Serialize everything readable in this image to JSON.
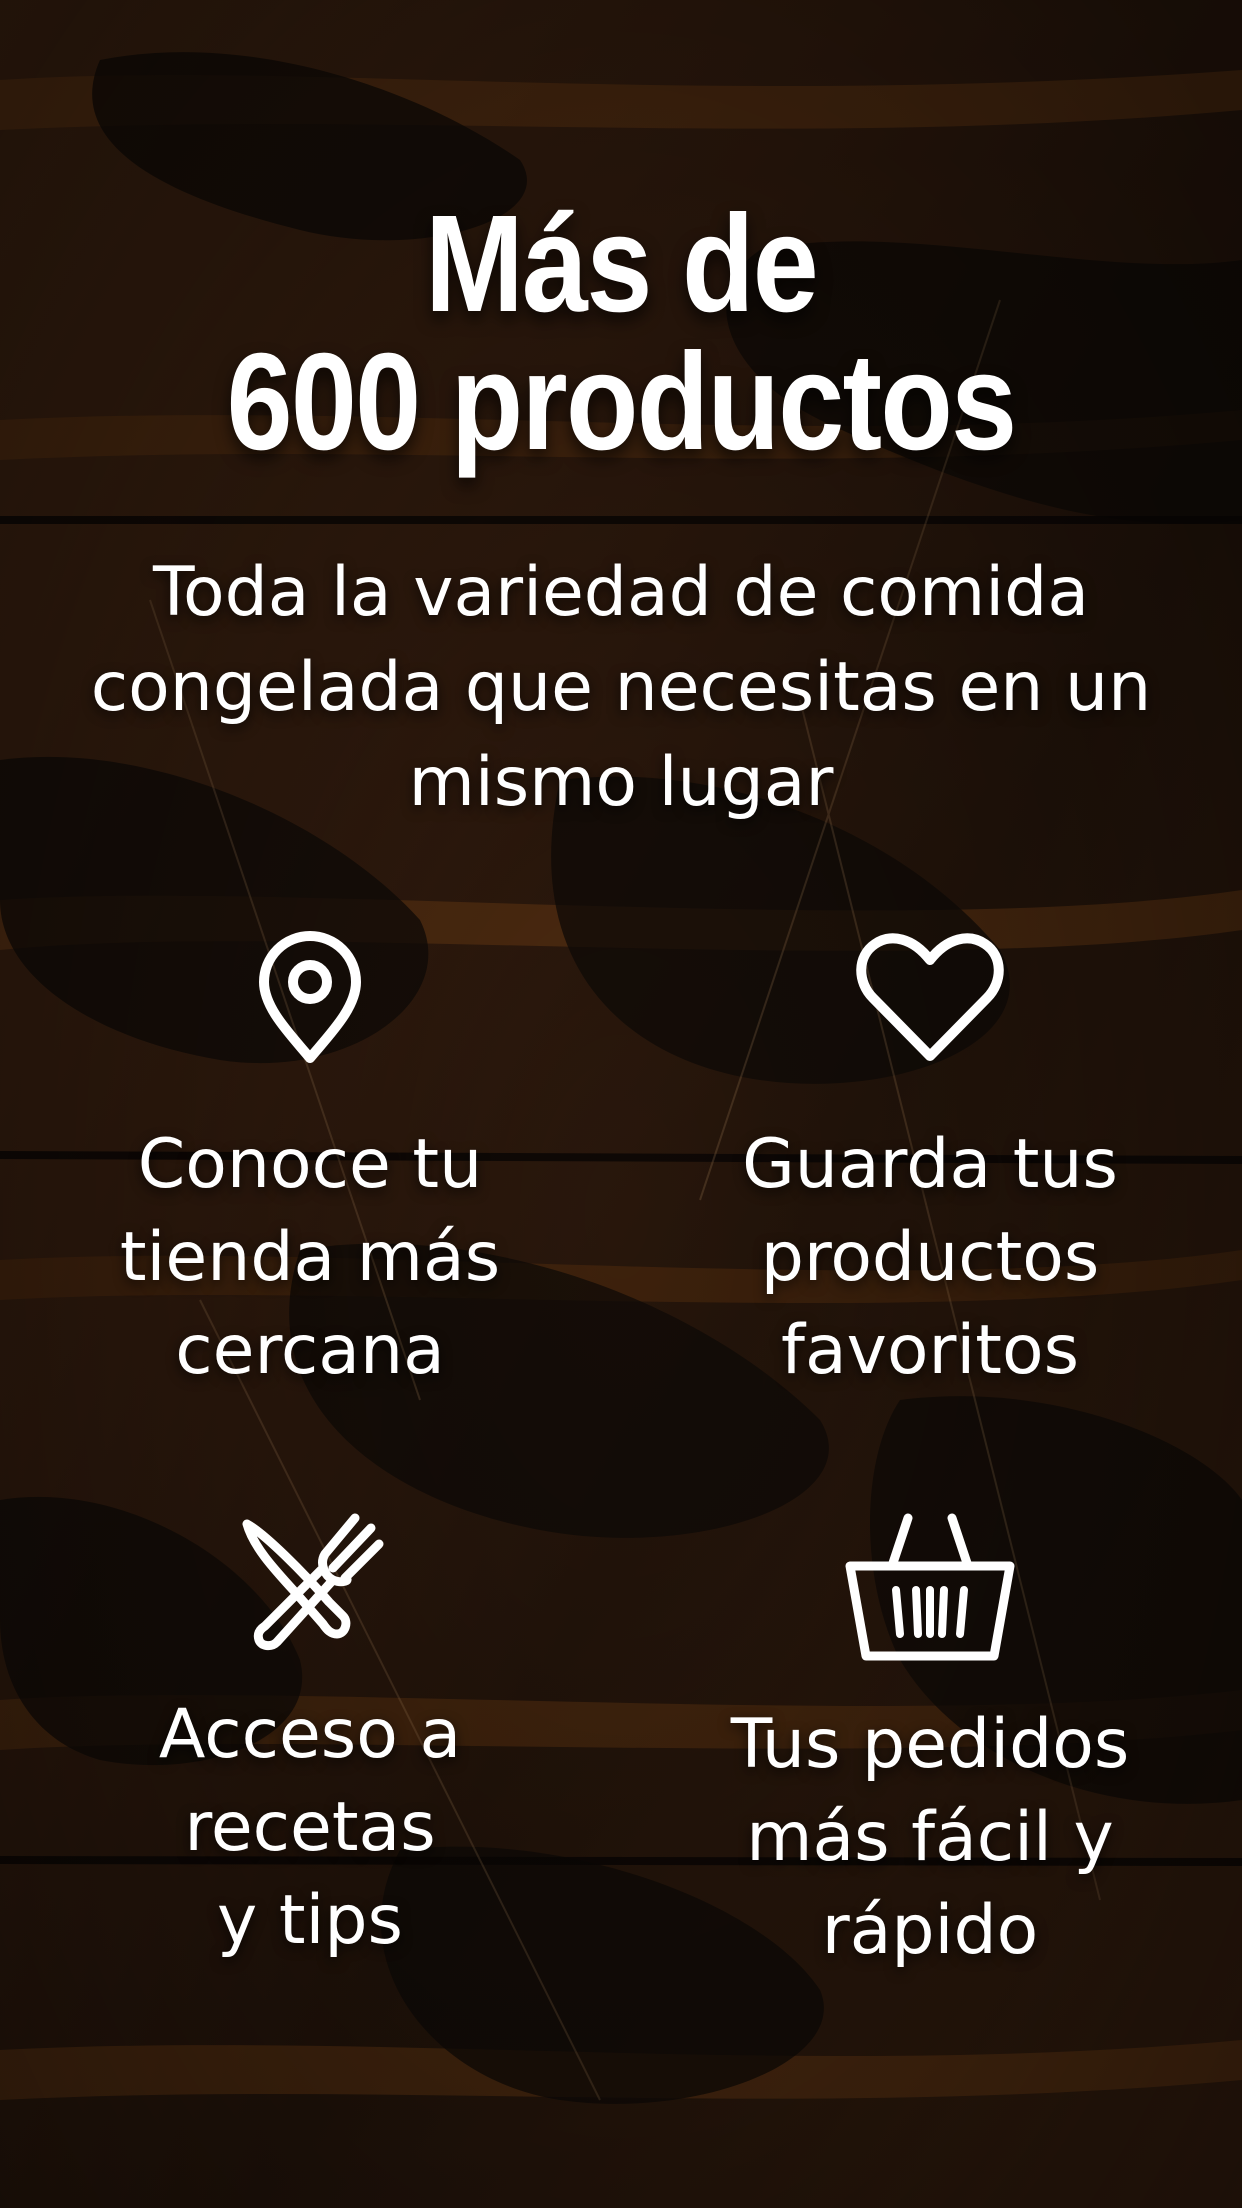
{
  "headline": {
    "line1": "Más de",
    "line2": "600 productos"
  },
  "subtitle": "Toda la variedad de comida congelada que necesitas en un mismo lugar",
  "features": [
    {
      "icon": "location-pin-icon",
      "label": "Conoce tu\ntienda más\ncercana"
    },
    {
      "icon": "heart-icon",
      "label": "Guarda tus\nproductos\nfavoritos"
    },
    {
      "icon": "knife-fork-icon",
      "label": "Acceso a\nrecetas\ny tips"
    },
    {
      "icon": "basket-icon",
      "label": "Tus pedidos\nmás fácil y\nrápido"
    }
  ],
  "colors": {
    "text": "#ffffff",
    "wood_dark": "#1c130d",
    "wood_light": "#6b3a16"
  }
}
